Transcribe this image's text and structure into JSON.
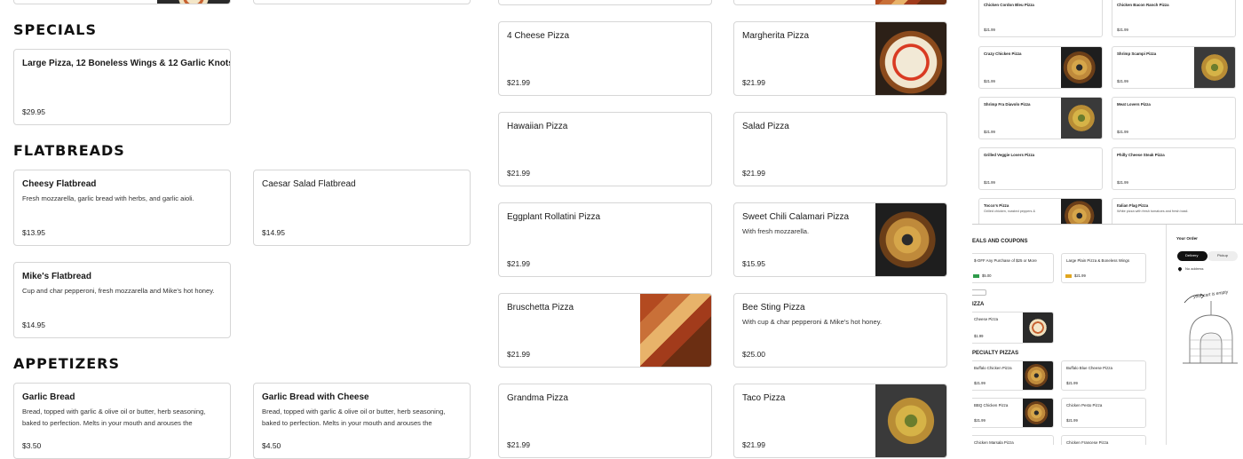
{
  "sections": {
    "specials": "SPECIALS",
    "flatbreads": "FLATBREADS",
    "appetizers": "APPETIZERS"
  },
  "left_items": {
    "special_combo": {
      "name": "Large Pizza, 12 Boneless Wings & 12 Garlic Knots",
      "price": "$29.95"
    },
    "cheesy_flatbread": {
      "name": "Cheesy Flatbread",
      "desc": "Fresh mozzarella, garlic bread with herbs, and garlic aioli.",
      "price": "$13.95"
    },
    "caesar_flatbread": {
      "name": "Caesar Salad Flatbread",
      "price": "$14.95"
    },
    "mikes_flatbread": {
      "name": "Mike's Flatbread",
      "desc": "Cup and char pepperoni, fresh mozzarella and Mike's hot honey.",
      "price": "$14.95"
    },
    "garlic_bread": {
      "name": "Garlic Bread",
      "desc": "Bread, topped with garlic & olive oil or butter, herb seasoning, baked to perfection. Melts in your mouth and arouses the",
      "price": "$3.50"
    },
    "garlic_bread_cheese": {
      "name": "Garlic Bread with Cheese",
      "desc": "Bread, topped with garlic & olive oil or butter, herb seasoning, baked to perfection. Melts in your mouth and arouses the",
      "price": "$4.50"
    }
  },
  "pizzas": {
    "four_cheese": {
      "name": "4 Cheese Pizza",
      "price": "$21.99"
    },
    "margherita": {
      "name": "Margherita Pizza",
      "price": "$21.99"
    },
    "hawaiian": {
      "name": "Hawaiian Pizza",
      "price": "$21.99"
    },
    "salad": {
      "name": "Salad Pizza",
      "price": "$21.99"
    },
    "eggplant": {
      "name": "Eggplant Rollatini Pizza",
      "price": "$21.99"
    },
    "sweet_chili": {
      "name": "Sweet Chili Calamari Pizza",
      "desc": "With fresh mozzarella.",
      "price": "$15.95"
    },
    "bruschetta": {
      "name": "Bruschetta Pizza",
      "price": "$21.99"
    },
    "bee_sting": {
      "name": "Bee Sting Pizza",
      "desc": "With cup & char pepperoni & Mike's hot honey.",
      "price": "$25.00"
    },
    "grandma": {
      "name": "Grandma Pizza",
      "price": "$21.99"
    },
    "taco": {
      "name": "Taco Pizza",
      "price": "$21.99"
    }
  },
  "right_panel": {
    "cards": [
      {
        "name": "Chicken Cordon Bleu Pizza",
        "price": "$21.99"
      },
      {
        "name": "Chicken Bacon Ranch Pizza",
        "price": "$21.99"
      },
      {
        "name": "Crazy Chicken Pizza",
        "price": "$21.99"
      },
      {
        "name": "Shrimp Scampi Pizza",
        "price": "$21.99"
      },
      {
        "name": "Shrimp Fra Diavolo Pizza",
        "price": "$21.99"
      },
      {
        "name": "Meat Lovers Pizza",
        "price": "$21.99"
      },
      {
        "name": "Grilled Veggie Lovers Pizza",
        "price": "$21.99"
      },
      {
        "name": "Philly Cheese Steak Pizza",
        "price": "$21.99"
      },
      {
        "name": "Tocco's Pizza",
        "desc": "Grilled chicken, roasted peppers &"
      },
      {
        "name": "Italian Flag Pizza",
        "desc": "White pizza with fresh tomatoes and fresh basil."
      }
    ],
    "deals_heading": "EALS AND COUPONS",
    "deal1": "$-OFF Any Purchase of $25 or More",
    "deal1_price": "$5.00",
    "deal2": "Large Plain Pizza & Boneless Wings",
    "deal2_price": "$21.99",
    "pizza_heading": "IZZA",
    "cheese_pizza": "Cheese Pizza",
    "cheese_price": "$1.99",
    "specialty_heading": "PECIALTY PIZZAS",
    "mini": [
      {
        "name": "Buffalo Chicken Pizza",
        "price": "$21.99"
      },
      {
        "name": "Buffalo Blue Cheese Pizza",
        "price": "$21.99"
      },
      {
        "name": "BBQ Chicken Pizza",
        "price": "$21.99"
      },
      {
        "name": "Chicken Pesto Pizza",
        "price": "$21.99"
      },
      {
        "name": "Chicken Marsala Pizza"
      },
      {
        "name": "Chicken Francese Pizza"
      }
    ],
    "order_title": "Your Order",
    "delivery": "Delivery",
    "pickup": "Pickup",
    "no_address": "No address",
    "empty_cart": "your cart is empty"
  }
}
